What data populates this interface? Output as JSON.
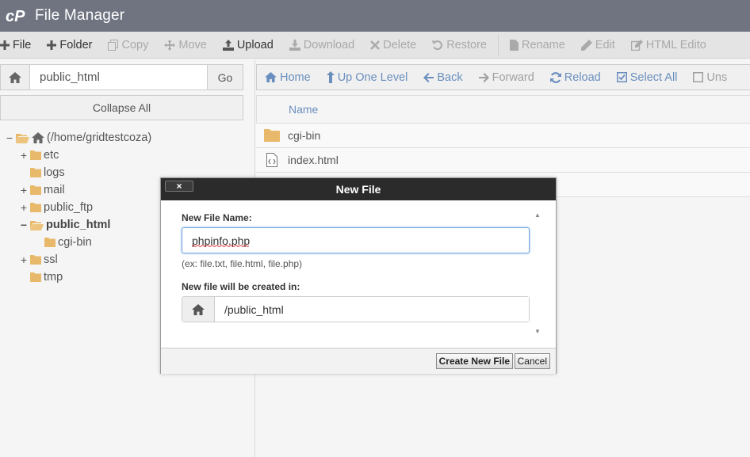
{
  "header": {
    "title": "File Manager",
    "logo_icon": "cpanel-logo-icon"
  },
  "toolbar": {
    "items": [
      {
        "label": "File",
        "icon": "plus-icon",
        "enabled": true
      },
      {
        "label": "Folder",
        "icon": "plus-icon",
        "enabled": true
      },
      {
        "label": "Copy",
        "icon": "copy-icon",
        "enabled": false
      },
      {
        "label": "Move",
        "icon": "move-icon",
        "enabled": false
      },
      {
        "label": "Upload",
        "icon": "upload-icon",
        "enabled": true
      },
      {
        "label": "Download",
        "icon": "download-icon",
        "enabled": false
      },
      {
        "label": "Delete",
        "icon": "x-icon",
        "enabled": false
      },
      {
        "label": "Restore",
        "icon": "undo-icon",
        "enabled": false
      },
      {
        "label": "Rename",
        "icon": "file-icon",
        "enabled": false
      },
      {
        "label": "Edit",
        "icon": "pencil-icon",
        "enabled": false
      },
      {
        "label": "HTML Edito",
        "icon": "html-edit-icon",
        "enabled": false
      }
    ]
  },
  "left": {
    "path_value": "public_html",
    "go_label": "Go",
    "collapse_label": "Collapse All",
    "tree": [
      {
        "label": "(/home/gridtestcoza)",
        "toggle": "−",
        "icon": "home-icon",
        "open": true
      },
      {
        "label": "etc",
        "toggle": "+"
      },
      {
        "label": "logs",
        "toggle": ""
      },
      {
        "label": "mail",
        "toggle": "+"
      },
      {
        "label": "public_ftp",
        "toggle": "+"
      },
      {
        "label": "public_html",
        "toggle": "−",
        "open": true,
        "bold": true
      },
      {
        "label": "cgi-bin",
        "toggle": ""
      },
      {
        "label": "ssl",
        "toggle": "+"
      },
      {
        "label": "tmp",
        "toggle": ""
      }
    ]
  },
  "nav": {
    "items": [
      {
        "label": "Home",
        "icon": "home-icon",
        "enabled": true
      },
      {
        "label": "Up One Level",
        "icon": "level-up-icon",
        "enabled": true
      },
      {
        "label": "Back",
        "icon": "arrow-left-icon",
        "enabled": true
      },
      {
        "label": "Forward",
        "icon": "arrow-right-icon",
        "enabled": false
      },
      {
        "label": "Reload",
        "icon": "refresh-icon",
        "enabled": true
      },
      {
        "label": "Select All",
        "icon": "checkbox-checked-icon",
        "enabled": true
      },
      {
        "label": "Uns",
        "icon": "checkbox-empty-icon",
        "enabled": false
      }
    ]
  },
  "files": {
    "header_name": "Name",
    "rows": [
      {
        "name": "cgi-bin",
        "icon": "folder-icon"
      },
      {
        "name": "index.html",
        "icon": "html-file-icon"
      }
    ]
  },
  "dialog": {
    "title": "New File",
    "close_label": "×",
    "name_label": "New File Name:",
    "name_value": "phpinfo.php",
    "hint": "(ex: file.txt, file.html, file.php)",
    "dest_label": "New file will be created in:",
    "dest_value": "/public_html",
    "create_label": "Create New File",
    "cancel_label": "Cancel"
  },
  "colors": {
    "header_bg": "#6f7480",
    "folder": "#e8b96a",
    "link_blue": "#6a8fbe",
    "dialog_head": "#2b2b2b"
  }
}
